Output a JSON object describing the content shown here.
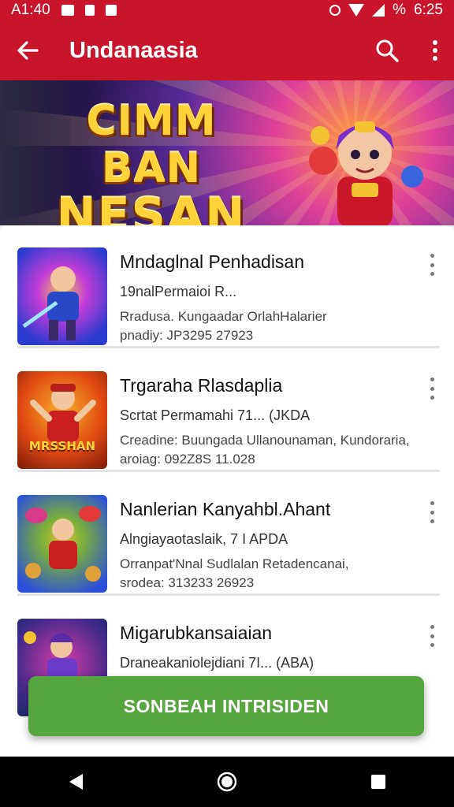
{
  "status_bar": {
    "time": "A1:40",
    "battery": "%",
    "clock": "6:25"
  },
  "app_bar": {
    "title": "Undanaasia",
    "back_icon": "back-arrow-icon",
    "search_icon": "search-icon",
    "more_icon": "more-vert-icon"
  },
  "banner": {
    "title_line1": "CIMM BAN",
    "title_line2": "NESAN",
    "carousel_pages": 4,
    "active_page": 2,
    "colors": {
      "gold": "#ffd23a",
      "purple": "#5a2a9a",
      "pink": "#e0409a",
      "orange": "#ff9a3c"
    }
  },
  "items": [
    {
      "title": "Mndaglnal Penhadisan",
      "subtitle": "19nalPermaioi R...",
      "description": "Rradusa. Kungaadar OrlahHalarier",
      "meta": "pnadiy: JP3295  27923",
      "thumb_colors": [
        "#2a3bd0",
        "#c43cd8"
      ]
    },
    {
      "title": "Trgaraha Rlasdaplia",
      "subtitle": "Scrtat Permamahi 71... (JKDA",
      "description": "Creadine: Buungada Ullanounaman, Kundoraria,",
      "meta": "aroiag: 092Z8S  11.028",
      "thumb_colors": [
        "#e24a12",
        "#f5b12a"
      ],
      "thumb_label": "MRSSHAN"
    },
    {
      "title": "Nanlerian Kanyahbl.Ahant",
      "subtitle": "Alngiayaotaslaik, 7 I    APDA",
      "description": "Orranpat'Nnal Sudlalan Retadencanai,",
      "meta": "srodea: 313233  26923",
      "thumb_colors": [
        "#2b4fd8",
        "#e0c23a"
      ]
    },
    {
      "title": "Migarubkansaiaian",
      "subtitle": "Draneakaniolejdiani 7I... (ABA)",
      "description": "",
      "meta": "",
      "thumb_colors": [
        "#3f2a8a",
        "#d83aa8"
      ]
    }
  ],
  "cta": {
    "label": "SONBEAH INTRISIDEN",
    "color": "#56a63f"
  },
  "nav": {
    "back": "nav-back-icon",
    "home": "nav-home-icon",
    "recents": "nav-recents-icon"
  }
}
